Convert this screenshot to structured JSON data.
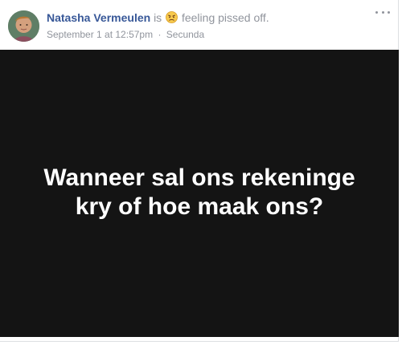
{
  "post": {
    "author": "Natasha Vermeulen",
    "is_word": "is",
    "feeling_icon": "angry-emoji-icon",
    "feeling": "feeling pissed off.",
    "date": "September 1 at 12:57pm",
    "separator": "·",
    "location": "Secunda",
    "more_icon": "more-options-icon",
    "image_text": "Wanneer sal ons rekeninge kry of hoe maak ons?"
  },
  "colors": {
    "name_blue": "#385898",
    "muted_gray": "#90949c",
    "image_background": "#141414",
    "image_text": "#ffffff",
    "emoji_face": "#f7c94d"
  }
}
